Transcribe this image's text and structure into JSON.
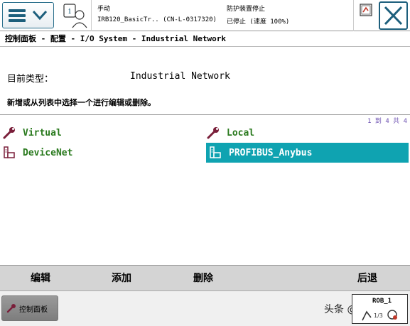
{
  "status": {
    "mode": "手动",
    "robot": "IRB120_BasicTr..  (CN-L-0317320)",
    "guard": "防护装置停止",
    "state": "已停止 (速度 100%)"
  },
  "breadcrumb": "控制面板 - 配置 - I/O System - Industrial Network",
  "type_label": "目前类型：",
  "type_value": "Industrial Network",
  "instruction": "新增或从列表中选择一个进行编辑或删除。",
  "pager": "1 到 4 共 4",
  "items": [
    {
      "label": "Virtual",
      "icon": "wrench-icon",
      "selected": false
    },
    {
      "label": "Local",
      "icon": "wrench-icon",
      "selected": false
    },
    {
      "label": "DeviceNet",
      "icon": "network-device-icon",
      "selected": false
    },
    {
      "label": "PROFIBUS_Anybus",
      "icon": "network-device-icon",
      "selected": true
    }
  ],
  "commands": {
    "edit": "编辑",
    "add": "添加",
    "delete": "删除",
    "back": "后退"
  },
  "taskbar": {
    "control_panel": "控制面板",
    "rob_label": "ROB_1",
    "watermark": "头条 @工控小翔"
  },
  "colors": {
    "accent": "#1d5f7c",
    "item_text": "#2a7a1e",
    "selected_bg": "#0fa3b1",
    "pager": "#6b4fb0"
  }
}
